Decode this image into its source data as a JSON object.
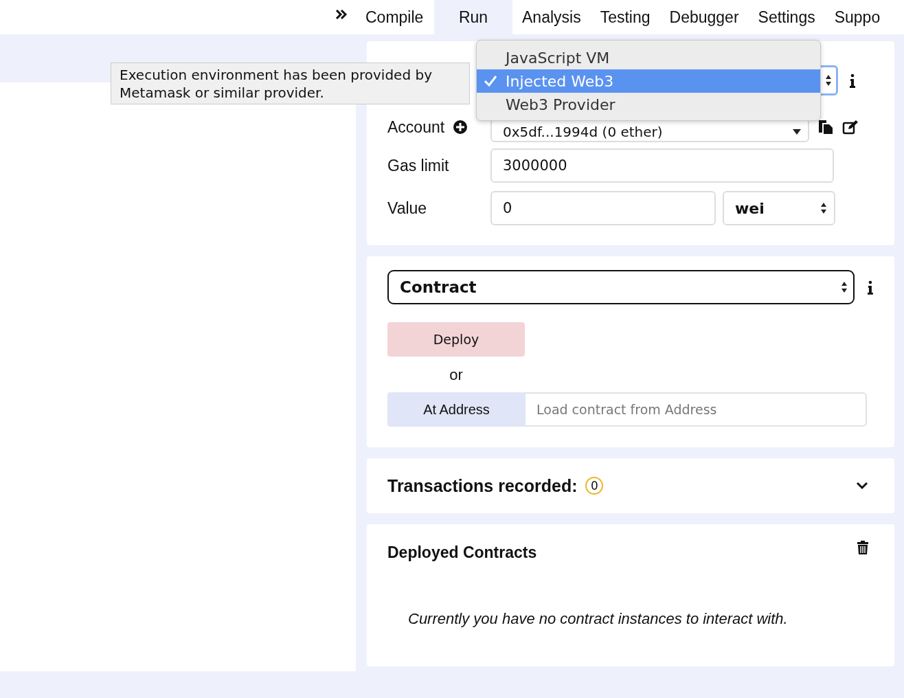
{
  "tabs": [
    {
      "label": "Compile",
      "selected": false
    },
    {
      "label": "Run",
      "selected": true
    },
    {
      "label": "Analysis",
      "selected": false
    },
    {
      "label": "Testing",
      "selected": false
    },
    {
      "label": "Debugger",
      "selected": false
    },
    {
      "label": "Settings",
      "selected": false
    },
    {
      "label": "Suppo",
      "selected": false
    }
  ],
  "environment": {
    "options": [
      {
        "label": "JavaScript VM",
        "selected": false
      },
      {
        "label": "Injected Web3",
        "selected": true
      },
      {
        "label": "Web3 Provider",
        "selected": false
      }
    ],
    "tooltip": "Execution environment has been provided by Metamask or similar provider."
  },
  "account": {
    "label": "Account",
    "value": "0x5df...1994d (0 ether)"
  },
  "gas_limit": {
    "label": "Gas limit",
    "value": "3000000"
  },
  "value": {
    "label": "Value",
    "amount": "0",
    "unit": "wei"
  },
  "contract": {
    "value": "Contract",
    "deploy": "Deploy",
    "or": "or",
    "at_address": "At Address",
    "placeholder": "Load contract from Address"
  },
  "transactions": {
    "label": "Transactions recorded:",
    "count": "0"
  },
  "deployed": {
    "title": "Deployed Contracts",
    "message": "Currently you have no contract instances to interact with."
  }
}
